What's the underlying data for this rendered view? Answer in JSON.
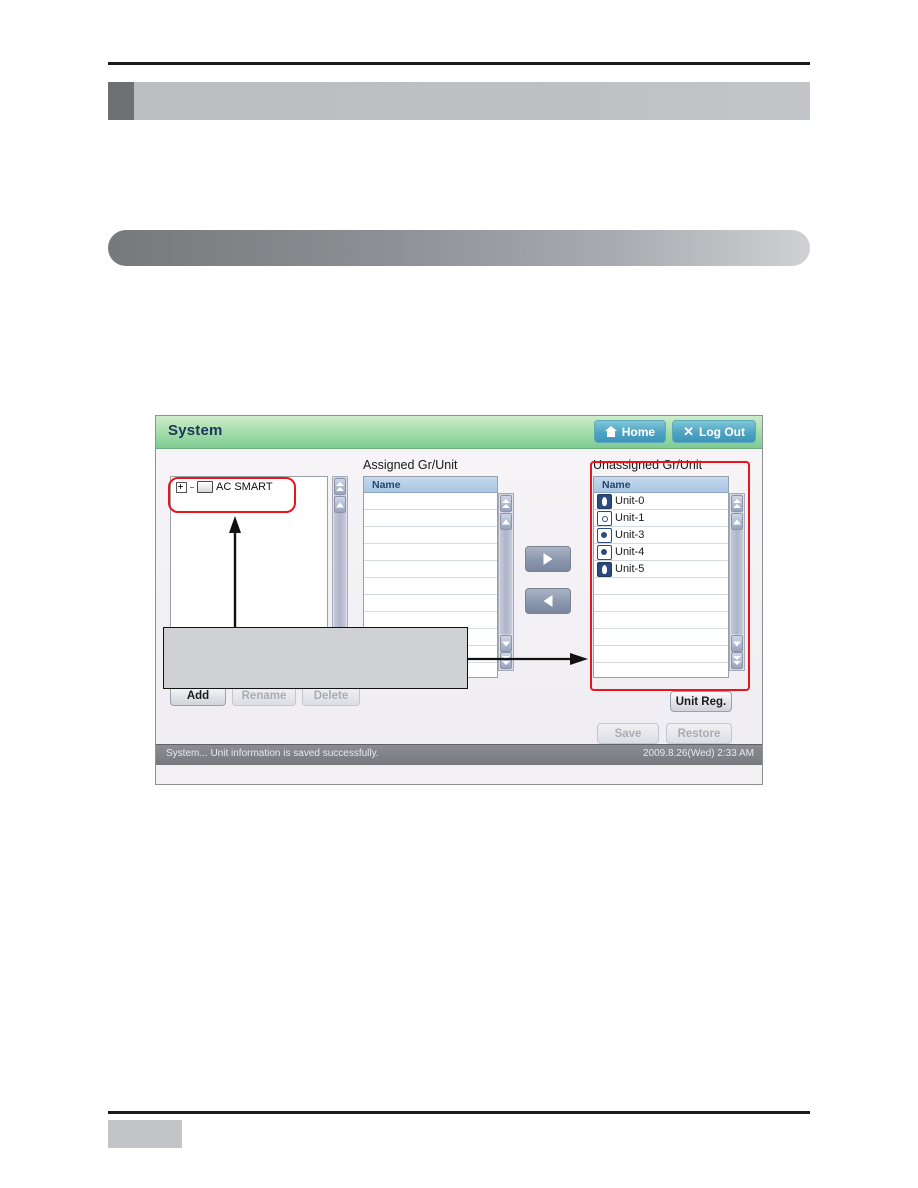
{
  "app": {
    "title": "System",
    "titlebar_buttons": [
      {
        "label": "Home",
        "icon": "home-icon"
      },
      {
        "label": "Log Out",
        "icon": "close-x-icon"
      }
    ],
    "tree": {
      "root_label": "AC SMART",
      "expander": "plus-box-icon",
      "node_icon": "monitor-icon"
    },
    "assigned_panel": {
      "label": "Assigned Gr/Unit",
      "column_header": "Name",
      "rows": []
    },
    "unassigned_panel": {
      "label": "Unassigned Gr/Unit",
      "column_header": "Name",
      "rows": [
        {
          "name": "Unit-0",
          "icon": "indoor-unit-icon"
        },
        {
          "name": "Unit-1",
          "icon": "ventilation-unit-icon"
        },
        {
          "name": "Unit-3",
          "icon": "house-unit-icon"
        },
        {
          "name": "Unit-4",
          "icon": "house-unit-icon"
        },
        {
          "name": "Unit-5",
          "icon": "indoor-unit-icon"
        }
      ]
    },
    "transfer_buttons": [
      {
        "name": "assign-right",
        "icon": "triangle-right-icon"
      },
      {
        "name": "unassign-left",
        "icon": "triangle-left-icon"
      }
    ],
    "group_buttons": [
      {
        "label": "Add",
        "enabled": true
      },
      {
        "label": "Rename",
        "enabled": false
      },
      {
        "label": "Delete",
        "enabled": false
      }
    ],
    "action_buttons": [
      {
        "label": "Unit Reg.",
        "enabled": true
      },
      {
        "label": "Save",
        "enabled": false
      },
      {
        "label": "Restore",
        "enabled": false
      }
    ],
    "statusbar": {
      "message": "System... Unit information is saved successfully.",
      "datetime": "2009.8.26(Wed) 2:33 AM"
    },
    "colors": {
      "titlebar_green": "#7ecb92",
      "title_text": "#1d3557",
      "titlebar_button": "#4fa4c3",
      "list_header": "#a9c6e4",
      "annotation_red": "#e8141e",
      "statusbar": "#76787d"
    }
  },
  "annotations": {
    "tree_highlight": "red-rounded-box-around-ac-smart",
    "unassigned_highlight": "red-box-around-unassigned-panel",
    "callout_box": "",
    "arrow_up": "arrow-from-callout-to-tree-node",
    "arrow_right": "arrow-from-callout-to-unassigned-panel"
  }
}
